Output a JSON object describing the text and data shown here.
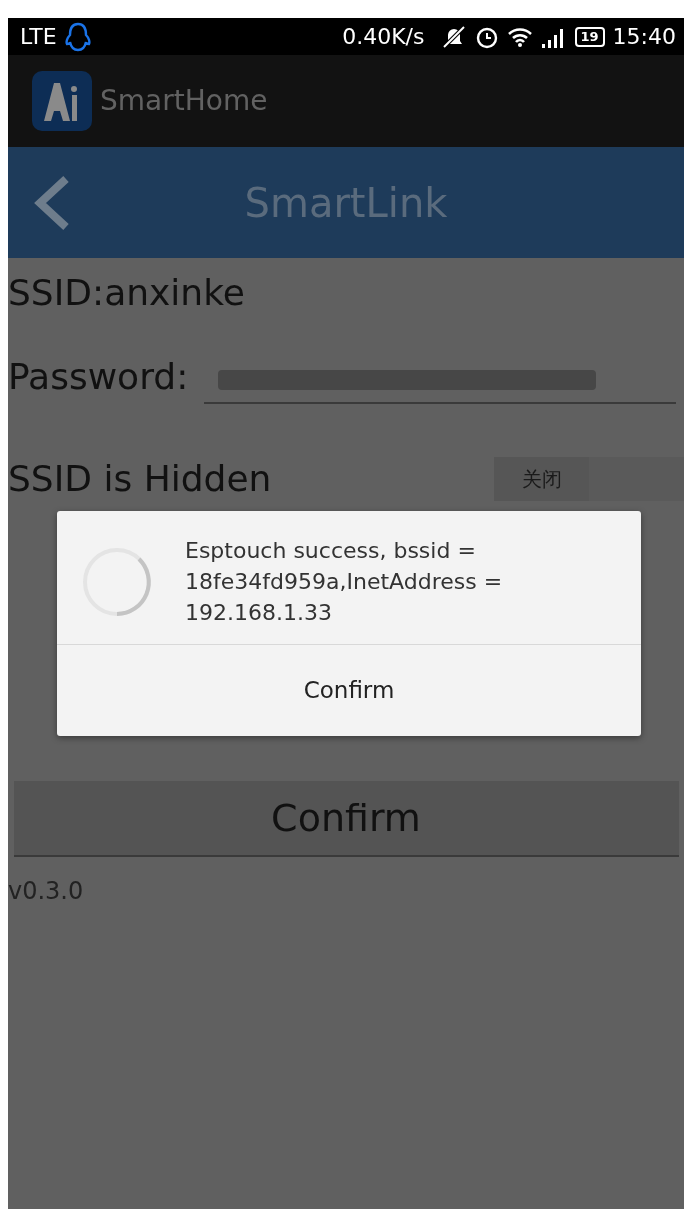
{
  "status_bar": {
    "carrier": "LTE",
    "speed": "0.40K/s",
    "battery": "19",
    "time": "15:40"
  },
  "app_bar": {
    "title": "SmartHome"
  },
  "toolbar": {
    "title": "SmartLink"
  },
  "form": {
    "ssid": "SSID:anxinke",
    "password_label": "Password:",
    "hidden_label": "SSID is Hidden",
    "hidden_toggle": {
      "label": "关闭",
      "on": false
    },
    "confirm": "Confirm",
    "version": "v0.3.0"
  },
  "dialog": {
    "message": "Esptouch success, bssid = 18fe34fd959a,InetAddress = 192.168.1.33",
    "button": "Confirm"
  }
}
